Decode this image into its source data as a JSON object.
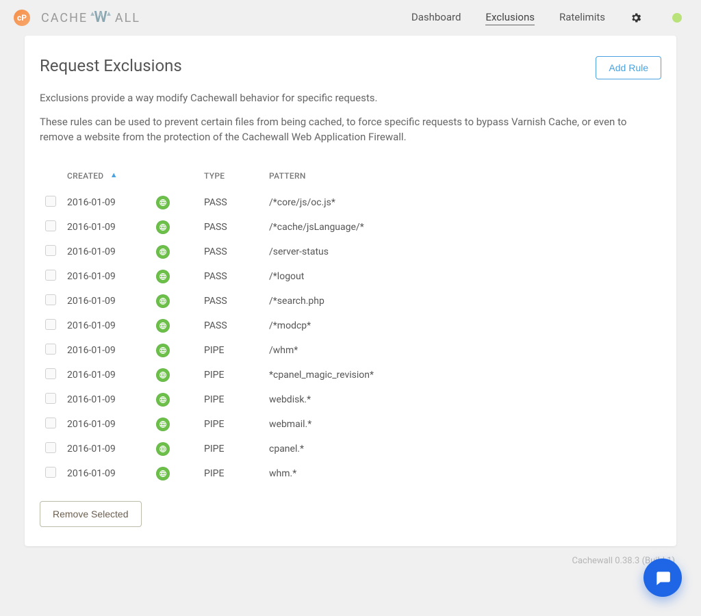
{
  "brand": {
    "logo_text": "CACHEWALL"
  },
  "nav": {
    "items": [
      {
        "label": "Dashboard",
        "active": false
      },
      {
        "label": "Exclusions",
        "active": true
      },
      {
        "label": "Ratelimits",
        "active": false
      }
    ]
  },
  "page": {
    "title": "Request Exclusions",
    "add_button": "Add Rule",
    "intro_1": "Exclusions provide a way modify Cachewall behavior for specific requests.",
    "intro_2": "These rules can be used to prevent certain files from being cached, to force specific requests to bypass Varnish Cache, or even to remove a website from the protection of the Cachewall Web Application Firewall."
  },
  "table": {
    "headers": {
      "created": "CREATED",
      "type": "TYPE",
      "pattern": "PATTERN"
    },
    "sort": {
      "column": "created",
      "direction": "asc"
    },
    "rows": [
      {
        "created": "2016-01-09",
        "type": "PASS",
        "pattern": "/*core/js/oc.js*"
      },
      {
        "created": "2016-01-09",
        "type": "PASS",
        "pattern": "/*cache/jsLanguage/*"
      },
      {
        "created": "2016-01-09",
        "type": "PASS",
        "pattern": "/server-status"
      },
      {
        "created": "2016-01-09",
        "type": "PASS",
        "pattern": "/*logout"
      },
      {
        "created": "2016-01-09",
        "type": "PASS",
        "pattern": "/*search.php"
      },
      {
        "created": "2016-01-09",
        "type": "PASS",
        "pattern": "/*modcp*"
      },
      {
        "created": "2016-01-09",
        "type": "PIPE",
        "pattern": "/whm*"
      },
      {
        "created": "2016-01-09",
        "type": "PIPE",
        "pattern": "*cpanel_magic_revision*"
      },
      {
        "created": "2016-01-09",
        "type": "PIPE",
        "pattern": "webdisk.*"
      },
      {
        "created": "2016-01-09",
        "type": "PIPE",
        "pattern": "webmail.*"
      },
      {
        "created": "2016-01-09",
        "type": "PIPE",
        "pattern": "cpanel.*"
      },
      {
        "created": "2016-01-09",
        "type": "PIPE",
        "pattern": "whm.*"
      }
    ]
  },
  "actions": {
    "remove_selected": "Remove Selected"
  },
  "footer": {
    "version": "Cachewall 0.38.3 (Build 1)"
  },
  "colors": {
    "accent": "#4aa3e0",
    "ok": "#6cc04a",
    "fab": "#1e66e5"
  }
}
